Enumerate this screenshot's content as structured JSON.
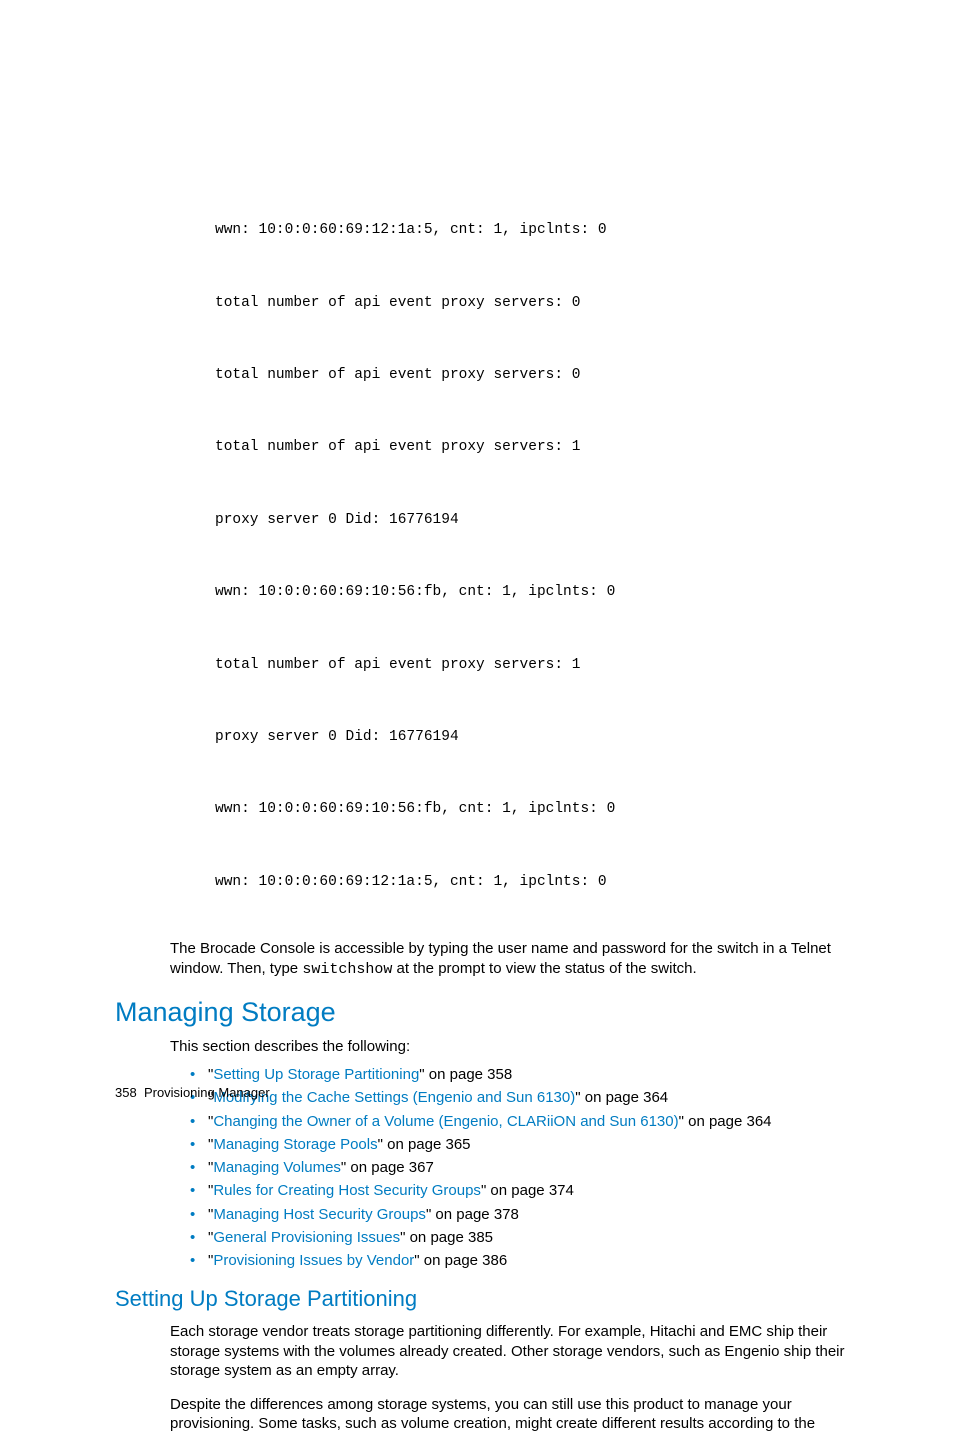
{
  "code": {
    "l1": "wwn: 10:0:0:60:69:12:1a:5, cnt: 1, ipclnts: 0",
    "l2": "total number of api event proxy servers: 0",
    "l3": "total number of api event proxy servers: 0",
    "l4": "total number of api event proxy servers: 1",
    "l5": "proxy server 0 Did: 16776194",
    "l6": "wwn: 10:0:0:60:69:10:56:fb, cnt: 1, ipclnts: 0",
    "l7": "total number of api event proxy servers: 1",
    "l8": "proxy server 0 Did: 16776194",
    "l9": "wwn: 10:0:0:60:69:10:56:fb, cnt: 1, ipclnts: 0",
    "l10": "wwn: 10:0:0:60:69:12:1a:5, cnt: 1, ipclnts: 0"
  },
  "body1a": "The Brocade Console is accessible by typing the user name and password for the switch in a Telnet window. Then, type ",
  "body1code": "switchshow",
  "body1b": " at the prompt to view the status of the switch.",
  "h1": "Managing Storage",
  "intro": "This section describes the following:",
  "toc": [
    {
      "link": "Setting Up Storage Partitioning",
      "suffix": " on page 358"
    },
    {
      "link": "Modifying the Cache Settings (Engenio and Sun 6130)",
      "suffix": " on page 364"
    },
    {
      "link": "Changing the Owner of a Volume (Engenio, CLARiiON and Sun 6130)",
      "suffix": " on page 364"
    },
    {
      "link": "Managing Storage Pools",
      "suffix": " on page 365"
    },
    {
      "link": "Managing Volumes",
      "suffix": " on page 367"
    },
    {
      "link": "Rules for Creating Host Security Groups",
      "suffix": " on page 374"
    },
    {
      "link": "Managing Host Security Groups",
      "suffix": " on page 378"
    },
    {
      "link": "General Provisioning Issues",
      "suffix": " on page 385"
    },
    {
      "link": "Provisioning Issues by Vendor",
      "suffix": " on page 386"
    }
  ],
  "h2": "Setting Up Storage Partitioning",
  "para1": "Each storage vendor treats storage partitioning differently. For example, Hitachi and EMC ship their storage systems with the volumes already created. Other storage vendors, such as Engenio ship their storage system as an empty array.",
  "para2": "Despite the differences among storage systems, you can still use this product to manage your provisioning. Some tasks, such as volume creation, might create different results according to the",
  "footer": {
    "page": "358",
    "label": "Provisioning Manager"
  }
}
